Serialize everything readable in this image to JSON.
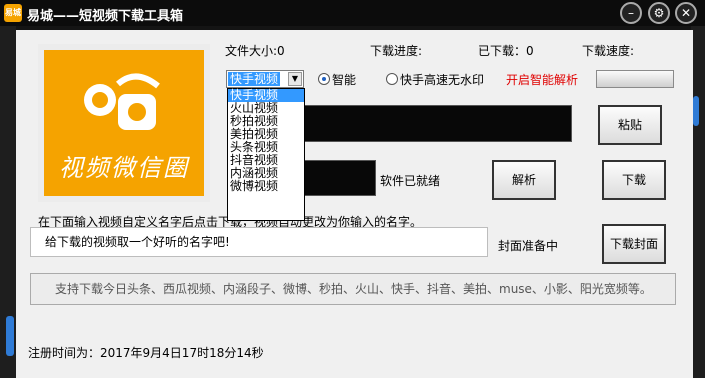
{
  "window": {
    "title": "易城——短视频下载工具箱",
    "icon_text": "易城",
    "controls": {
      "minimize": "–",
      "settings": "⚙",
      "close": "✕"
    }
  },
  "logo": {
    "text": "视频微信圈",
    "color": "#f5a300"
  },
  "stats": {
    "file_size": "文件大小:0",
    "download_progress": "下载进度:",
    "downloaded": "已下载：0",
    "download_speed": "下载速度:"
  },
  "platform_select": {
    "selected": "快手视频",
    "options": [
      "快手视频",
      "火山视频",
      "秒拍视频",
      "美拍视频",
      "头条视频",
      "抖音视频",
      "内涵视频",
      "微博视频"
    ]
  },
  "options": {
    "smart_label": "智能",
    "smart_selected": true,
    "no_watermark_label": "快手高速无水印",
    "no_watermark_selected": false,
    "enable_smart_parse": "开启智能解析",
    "enable_color": "#e00000"
  },
  "buttons": {
    "paste": "粘贴",
    "parse": "解析",
    "download": "下载",
    "download_cover": "下载封面"
  },
  "status": {
    "software_ready": "软件已就绪",
    "cover_ready": "封面准备中"
  },
  "custom_name": {
    "hint": "在下面输入视频自定义名字后点击下载，视频自动更改为你输入的名字。",
    "placeholder": "给下载的视频取一个好听的名字吧!"
  },
  "supported": "支持下载今日头条、西瓜视频、内涵段子、微博、秒拍、火山、快手、抖音、美拍、muse、小影、阳光宽频等。",
  "registration": "注册时间为：2017年9月4日17时18分14秒"
}
